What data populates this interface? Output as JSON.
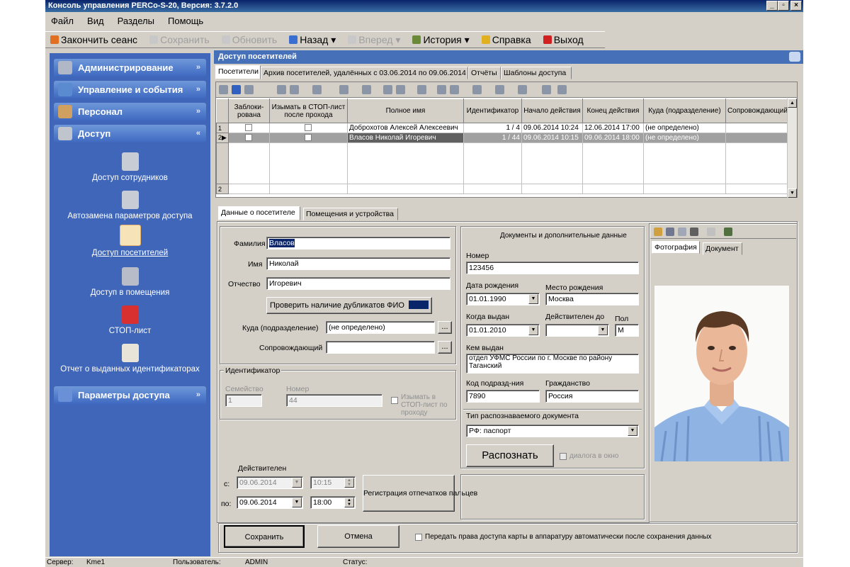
{
  "window": {
    "title": "Консоль управления PERCo-S-20, Версия: 3.7.2.0",
    "ctrl_min": "_",
    "ctrl_max": "▫",
    "ctrl_close": "×"
  },
  "menu": [
    "Файл",
    "Вид",
    "Разделы",
    "Помощь"
  ],
  "toolbar": {
    "end_session": "Закончить сеанс",
    "save": "Сохранить",
    "refresh": "Обновить",
    "back": "Назад",
    "forward": "Вперед",
    "history": "История",
    "help": "Справка",
    "exit": "Выход"
  },
  "sidebar": {
    "sections": {
      "admin": "Администрирование",
      "events": "Управление и события",
      "personnel": "Персонал",
      "access": "Доступ",
      "access_params": "Параметры доступа"
    },
    "access_items": [
      "Доступ сотрудников",
      "Автозамена параметров доступа",
      "Доступ посетителей",
      "Доступ в помещения",
      "СТОП-лист",
      "Отчет о выданных идентификаторах"
    ],
    "chev_down": "»",
    "chev_up": "«"
  },
  "panel": {
    "title": "Доступ посетителей",
    "tabs": [
      "Посетители",
      "Архив посетителей, удалённых с 03.06.2014 по 09.06.2014",
      "Отчёты",
      "Шаблоны доступа"
    ]
  },
  "grid": {
    "columns": [
      "Заблоки-рованa",
      "Изымать в СТОП-лист после прохода",
      "Полное имя",
      "Идентификатор",
      "Начало действия",
      "Конец действия",
      "Куда (подразделение)",
      "Сопровождающий"
    ],
    "rows": [
      {
        "n": "1",
        "name": "Доброхотов Алексей Алексеевич",
        "id": "1 / 4",
        "start": "09.06.2014 10:24",
        "end": "12.06.2014 17:00",
        "dept": "(не определено)",
        "escort": ""
      },
      {
        "n": "2",
        "name": "Власов Николай Игоревич",
        "id": "1 / 44",
        "start": "09.06.2014 10:15",
        "end": "09.06.2014 18:00",
        "dept": "(не определено)",
        "escort": ""
      }
    ],
    "footer_count": "2",
    "current_marker": "▶"
  },
  "detail_tabs": [
    "Данные о посетителе",
    "Помещения и устройства"
  ],
  "visitor": {
    "last_name_label": "Фамилия",
    "last_name": "Власов",
    "first_name_label": "Имя",
    "first_name": "Николай",
    "patronymic_label": "Отчество",
    "patronymic": "Игоревич",
    "check_dup_button": "Проверить наличие дубликатов ФИО",
    "dept_label": "Куда (подразделение)",
    "dept_value": "(не определено)",
    "escort_label": "Сопровождающий",
    "escort_value": "",
    "browse": "...",
    "identifier_group": "Идентификатор",
    "family_label": "Семейство",
    "family_value": "1",
    "number_label": "Номер",
    "number_value": "44",
    "seize_label": "Изымать в СТОП-лист по проходу",
    "valid_label": "Действителен",
    "from_label": "с:",
    "from_date": "09.06.2014",
    "from_time": "10:15",
    "to_label": "по:",
    "to_date": "09.06.2014",
    "to_time": "18:00",
    "register_button": "Регистрация отпечатков пальцев"
  },
  "docs": {
    "title": "Документы и дополнительные данные",
    "number_label": "Номер",
    "number_value": "123456",
    "birth_date_label": "Дата рождения",
    "birth_date": "01.01.1990",
    "birth_place_label": "Место рождения",
    "birth_place": "Москва",
    "issued_when_label": "Когда выдан",
    "issued_when": "01.01.2010",
    "valid_until_label": "Действителен до",
    "valid_until": "",
    "sex_label": "Пол",
    "sex": "М",
    "issued_by_label": "Кем выдан",
    "issued_by": "отдел УФМС России по г. Москве по району Таганский",
    "dept_code_label": "Код подразд-ния",
    "dept_code": "7890",
    "citizenship_label": "Гражданство",
    "citizenship": "Россия",
    "doc_type_label": "Тип распознаваемого документа",
    "doc_type": "РФ: паспорт",
    "recognize_button": "Распознать",
    "dialog_label": "диалога в окно"
  },
  "photo_tabs": [
    "Фотография",
    "Документ"
  ],
  "bottom": {
    "save": "Сохранить",
    "cancel": "Отмена",
    "transfer_label": "Передать права доступа карты в аппаратуру автоматически после сохранения данных"
  },
  "status": {
    "server_label": "Сервер:",
    "server": "Kme1",
    "user_label": "Пользователь:",
    "user": "ADMIN",
    "status_label": "Статус:"
  },
  "colors": {
    "title_bar": "#0a246a",
    "sidebar": "#3f66b8",
    "panel_header": "#4670b8",
    "selection": "#0a246a"
  }
}
